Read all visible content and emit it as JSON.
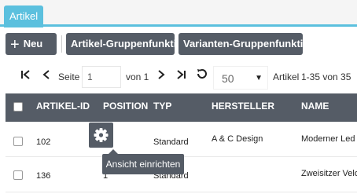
{
  "tab": {
    "label": "Artikel"
  },
  "toolbar": {
    "new_label": "Neu",
    "group_function_label": "Artikel-Gruppenfunktion",
    "variant_group_label": "Varianten-Gruppenfunktion"
  },
  "pager": {
    "page_label": "Seite",
    "page_value": "1",
    "of_label": "von 1",
    "per_page_value": "50",
    "summary_prefix": "Artikel",
    "summary_range": "1-35 von 35"
  },
  "table": {
    "columns": [
      "ARTIKEL-ID",
      "POSITION",
      "TYP",
      "HERSTELLER",
      "NAME"
    ],
    "rows": [
      {
        "id": "102",
        "position": "",
        "type": "Standard",
        "manufacturer": "A & C Design",
        "name": "Moderner Led"
      },
      {
        "id": "136",
        "position": "1",
        "type": "Standard",
        "manufacturer": "",
        "name": "Zweisitzer Velo"
      }
    ]
  },
  "tooltip": {
    "text": "Ansicht einrichten"
  },
  "colors": {
    "accent": "#5bc0de",
    "toolbar_button": "#555c66",
    "header_bg": "#555c66"
  },
  "icons": [
    "plus-icon",
    "first-page-icon",
    "prev-page-icon",
    "next-page-icon",
    "last-page-icon",
    "refresh-icon",
    "caret-down-icon",
    "gear-icon"
  ]
}
